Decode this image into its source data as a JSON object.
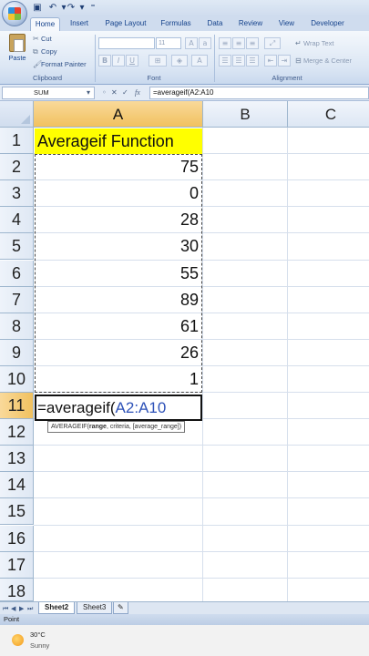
{
  "quick_access": {
    "icons": [
      "save-icon",
      "undo-icon",
      "redo-icon",
      "customize-icon"
    ]
  },
  "tabs": [
    {
      "label": "Home",
      "active": true
    },
    {
      "label": "Insert"
    },
    {
      "label": "Page Layout"
    },
    {
      "label": "Formulas"
    },
    {
      "label": "Data"
    },
    {
      "label": "Review"
    },
    {
      "label": "View"
    },
    {
      "label": "Developer"
    }
  ],
  "ribbon": {
    "clipboard": {
      "paste": "Paste",
      "cut": "Cut",
      "copy": "Copy",
      "format_painter": "Format Painter",
      "label": "Clipboard"
    },
    "font": {
      "size": "11",
      "label": "Font",
      "bold": "B",
      "italic": "I",
      "underline": "U"
    },
    "alignment": {
      "wrap_text": "Wrap Text",
      "merge_center": "Merge & Center",
      "label": "Alignment"
    }
  },
  "formula_bar": {
    "name_box": "SUM",
    "fx": "fx",
    "formula": "=averageif(A2:A10"
  },
  "columns": [
    "A",
    "B",
    "C"
  ],
  "rows": [
    "1",
    "2",
    "3",
    "4",
    "5",
    "6",
    "7",
    "8",
    "9",
    "10",
    "11",
    "12",
    "13",
    "14",
    "15",
    "16",
    "17",
    "18"
  ],
  "cells": {
    "A1": "Averageif Function",
    "A2_A10": [
      "75",
      "0",
      "28",
      "30",
      "55",
      "89",
      "61",
      "26",
      "1"
    ],
    "A11_prefix": "=averageif(",
    "A11_ref": "A2:A10"
  },
  "tooltip": {
    "fn": "AVERAGEIF(",
    "arg1": "range",
    "rest": ", criteria, [average_range])"
  },
  "sheet_tabs": [
    {
      "label": "Sheet2",
      "active": true
    },
    {
      "label": "Sheet3"
    }
  ],
  "status": {
    "mode": "Point"
  },
  "taskbar": {
    "temperature": "30°C",
    "condition": "Sunny"
  },
  "colors": {
    "header_selected": "#f1c15f",
    "title_fill": "#ffff00",
    "range_ref": "#2e52b8"
  }
}
